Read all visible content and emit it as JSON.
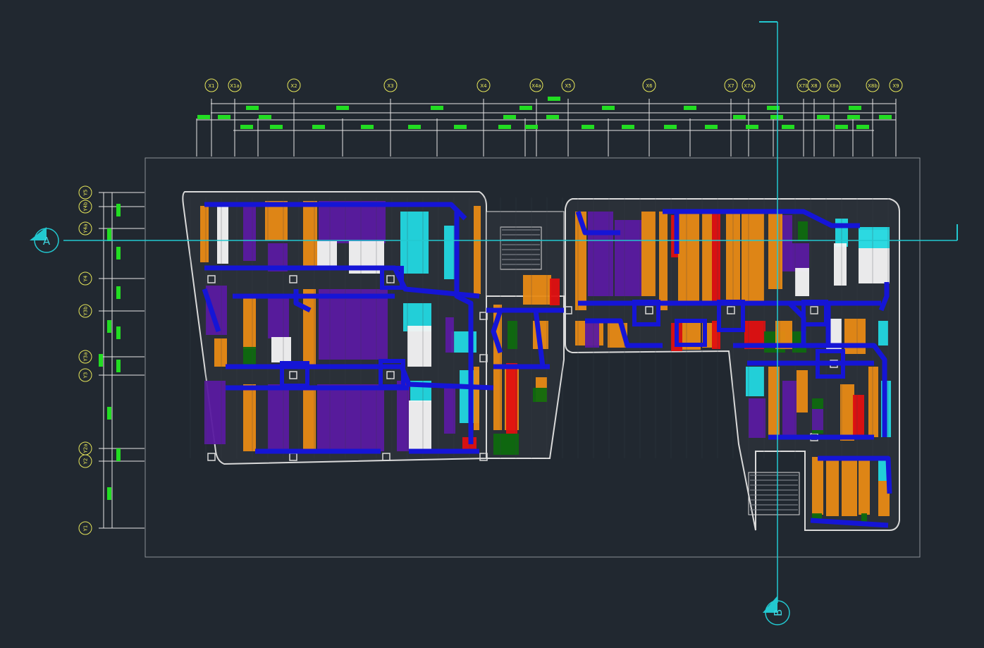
{
  "drawing": {
    "background": "#212830",
    "colors": {
      "grid_bubble": "#e8e85a",
      "dimension_line": "#e6e6e6",
      "dimension_tag": "#22dd22",
      "section_line": "#22c8d0",
      "frame": "#8a8f96",
      "wall": "#d9d9d9",
      "duct": "#1515d6",
      "zone_purple": "#5a1aa0",
      "zone_orange": "#e88a14",
      "zone_red": "#e01010",
      "zone_cyan": "#22d8e0",
      "zone_white": "#f4f4f4",
      "zone_green": "#0e6a0e"
    }
  },
  "grid_x": [
    "X1",
    "X1a",
    "X2",
    "X3",
    "X4",
    "X4a",
    "X5",
    "X6",
    "X7",
    "X7a",
    "X7b",
    "X8",
    "X8a",
    "X8b",
    "X9"
  ],
  "grid_y": [
    "Y5",
    "Y4b",
    "Y4a",
    "Y4",
    "Y3b",
    "Y3a",
    "Y3",
    "Y2a",
    "Y2",
    "Y1"
  ],
  "sections": {
    "a": {
      "label": "A"
    },
    "b": {
      "label": "B"
    }
  }
}
